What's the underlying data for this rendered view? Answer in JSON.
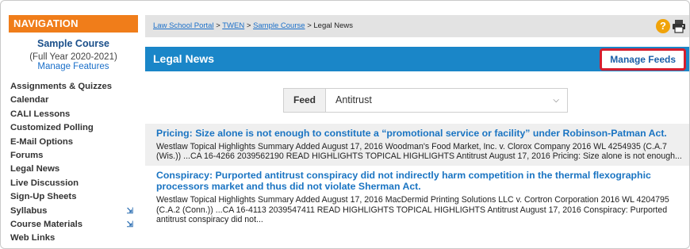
{
  "sidebar": {
    "header": "NAVIGATION",
    "course_title": "Sample Course",
    "course_year": "(Full Year 2020-2021)",
    "manage_features": "Manage Features",
    "items": [
      {
        "label": "Assignments & Quizzes",
        "ext": ""
      },
      {
        "label": "Calendar",
        "ext": ""
      },
      {
        "label": "CALI Lessons",
        "ext": ""
      },
      {
        "label": "Customized Polling",
        "ext": ""
      },
      {
        "label": "E-Mail Options",
        "ext": ""
      },
      {
        "label": "Forums",
        "ext": ""
      },
      {
        "label": "Legal News",
        "ext": ""
      },
      {
        "label": "Live Discussion",
        "ext": ""
      },
      {
        "label": "Sign-Up Sheets",
        "ext": ""
      },
      {
        "label": "Syllabus",
        "ext": "external-link-icon"
      },
      {
        "label": "Course Materials",
        "ext": "external-link-icon"
      },
      {
        "label": "Web Links",
        "ext": ""
      }
    ]
  },
  "breadcrumb": {
    "items": [
      "Law School Portal",
      "TWEN",
      "Sample Course"
    ],
    "current": "Legal News",
    "separator": ">"
  },
  "header": {
    "title": "Legal News",
    "manage_feeds": "Manage Feeds",
    "help_icon": "help-icon",
    "print_icon": "printer-icon"
  },
  "feed": {
    "label": "Feed",
    "selected": "Antitrust"
  },
  "results": [
    {
      "title": "Pricing: Size alone is not enough to constitute a “promotional service or facility” under Robinson-Patman Act.",
      "summary": "Westlaw Topical Highlights Summary Added August 17, 2016 Woodman's Food Market, Inc. v. Clorox Company 2016 WL 4254935 (C.A.7 (Wis.)) ...CA 16-4266 2039562190 READ HIGHLIGHTS TOPICAL HIGHLIGHTS Antitrust August 17, 2016 Pricing: Size alone is not enough..."
    },
    {
      "title": "Conspiracy: Purported antitrust conspiracy did not indirectly harm competition in the thermal flexographic processors market and thus did not violate Sherman Act.",
      "summary": "Westlaw Topical Highlights Summary Added August 17, 2016 MacDermid Printing Solutions LLC v. Cortron Corporation 2016 WL 4204795 (C.A.2 (Conn.)) ...CA 16-4113 2039547411 READ HIGHLIGHTS TOPICAL HIGHLIGHTS Antitrust August 17, 2016 Conspiracy: Purported antitrust conspiracy did not..."
    }
  ],
  "colors": {
    "nav_orange": "#f07d1a",
    "title_blue": "#1a86c8",
    "link_blue": "#1a74c2",
    "highlight_red": "#d61d2d"
  }
}
